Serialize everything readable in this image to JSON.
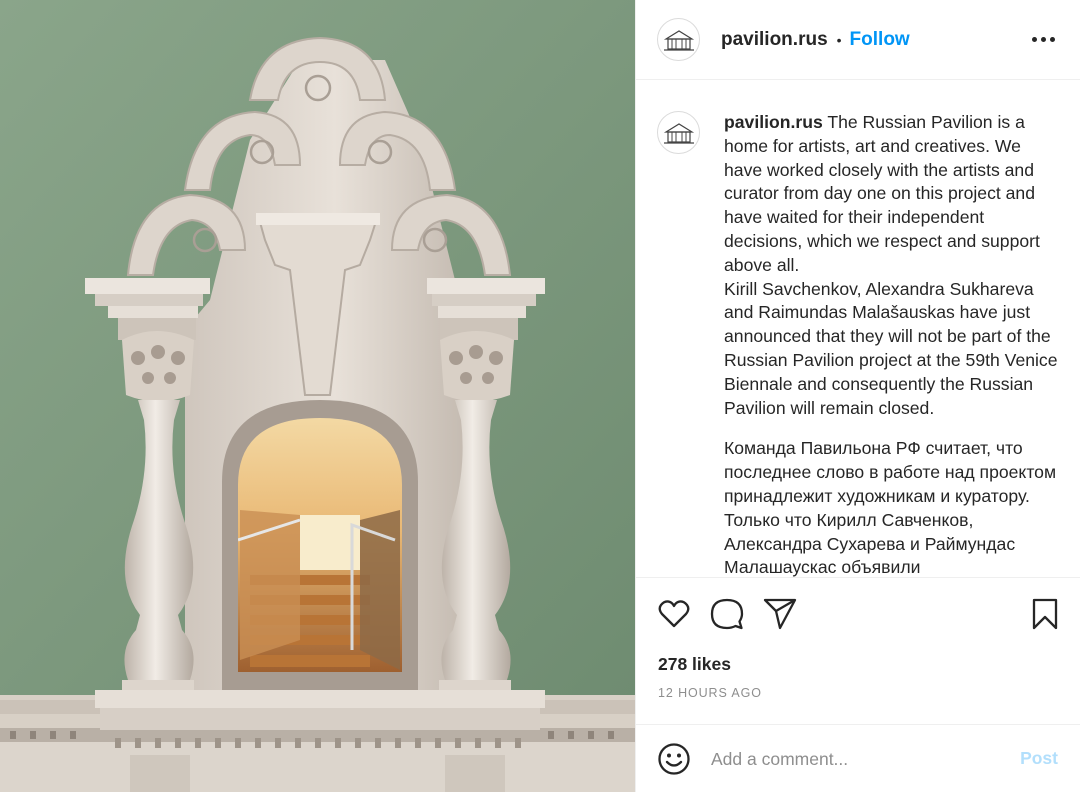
{
  "post": {
    "username": "pavilion.rus",
    "separator": "•",
    "follow_label": "Follow",
    "more_icon": "more-horizontal-icon"
  },
  "caption": {
    "username": "pavilion.rus",
    "paragraph_1": "The Russian Pavilion is a home for artists, art and creatives. We have worked closely with the artists and curator from day one on this project and have waited for their independent decisions, which we respect and support above all.",
    "paragraph_2": "Kirill Savchenkov, Alexandra Sukhareva and Raimundas Malašauskas have just announced that they will not be part of the Russian Pavilion project at the 59th Venice Biennale and consequently the Russian Pavilion will remain closed.",
    "paragraph_3": "Команда Павильона РФ считает, что последнее слово в работе над проектом принадлежит художникам и куратору. Только что Кирилл Савченков, Александра Сухарева и Раймундас Малашаускас объявили"
  },
  "actions": {
    "icons": [
      "heart-icon",
      "comment-icon",
      "share-icon",
      "bookmark-icon"
    ],
    "likes": "278 likes",
    "timestamp": "12 HOURS AGO"
  },
  "comment_box": {
    "emoji_icon": "emoji-icon",
    "placeholder": "Add a comment...",
    "post_label": "Post"
  },
  "colors": {
    "follow_blue": "#0095f6",
    "post_disabled": "#b2dffc",
    "wall_green": "#7f9a80",
    "text": "#262626",
    "muted": "#8e8e8e"
  }
}
